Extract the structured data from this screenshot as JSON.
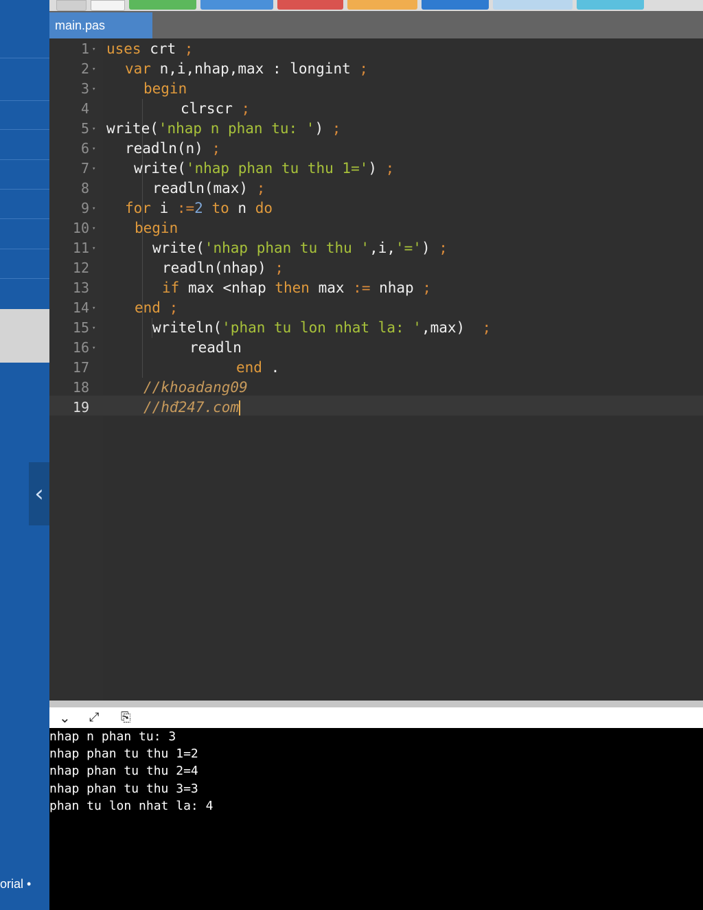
{
  "sidebar": {
    "collapse_glyph": "‹",
    "footer_text": "orial •"
  },
  "toolbar": {
    "colors": {
      "gray": "#cfcfcf",
      "run": "#5cb85c",
      "debug": "#4a90d9",
      "stop": "#d9534f",
      "share": "#f0ad4e",
      "save": "#2f7bd0",
      "beautify": "#b9d6ee",
      "extra": "#5bc0de"
    }
  },
  "tab": {
    "label": "main.pas"
  },
  "editor": {
    "active_line": 19,
    "lines": [
      {
        "n": "1",
        "fold": true
      },
      {
        "n": "2",
        "fold": true
      },
      {
        "n": "3",
        "fold": true
      },
      {
        "n": "4",
        "fold": false
      },
      {
        "n": "5",
        "fold": true
      },
      {
        "n": "6",
        "fold": true
      },
      {
        "n": "7",
        "fold": true
      },
      {
        "n": "8",
        "fold": false
      },
      {
        "n": "9",
        "fold": true
      },
      {
        "n": "10",
        "fold": true
      },
      {
        "n": "11",
        "fold": true
      },
      {
        "n": "12",
        "fold": false
      },
      {
        "n": "13",
        "fold": false
      },
      {
        "n": "14",
        "fold": true
      },
      {
        "n": "15",
        "fold": true
      },
      {
        "n": "16",
        "fold": true
      },
      {
        "n": "17",
        "fold": false
      },
      {
        "n": "18",
        "fold": false
      },
      {
        "n": "19",
        "fold": false
      }
    ],
    "code": [
      [
        {
          "t": "uses",
          "c": "kw"
        },
        {
          "t": " crt "
        },
        {
          "t": ";",
          "c": "op"
        }
      ],
      [
        {
          "t": "var",
          "c": "kw"
        },
        {
          "t": " n,i,nhap,max : longint "
        },
        {
          "t": ";",
          "c": "op"
        }
      ],
      [
        {
          "t": "begin",
          "c": "kw"
        }
      ],
      [
        {
          "t": "clrscr "
        },
        {
          "t": ";",
          "c": "op"
        }
      ],
      [
        {
          "t": "write("
        },
        {
          "t": "'nhap n phan tu: '",
          "c": "st"
        },
        {
          "t": ") "
        },
        {
          "t": ";",
          "c": "op"
        }
      ],
      [
        {
          "t": "readln(n) "
        },
        {
          "t": ";",
          "c": "op"
        }
      ],
      [
        {
          "t": "write("
        },
        {
          "t": "'nhap phan tu thu 1='",
          "c": "st"
        },
        {
          "t": ") "
        },
        {
          "t": ";",
          "c": "op"
        }
      ],
      [
        {
          "t": "readln(max) "
        },
        {
          "t": ";",
          "c": "op"
        }
      ],
      [
        {
          "t": "for",
          "c": "kw"
        },
        {
          "t": " i "
        },
        {
          "t": ":=",
          "c": "op"
        },
        {
          "t": "2",
          "c": "nm"
        },
        {
          "t": " "
        },
        {
          "t": "to",
          "c": "kw"
        },
        {
          "t": " n "
        },
        {
          "t": "do",
          "c": "kw"
        }
      ],
      [
        {
          "t": "begin",
          "c": "kw"
        }
      ],
      [
        {
          "t": "write("
        },
        {
          "t": "'nhap phan tu thu '",
          "c": "st"
        },
        {
          "t": ",i,"
        },
        {
          "t": "'='",
          "c": "st"
        },
        {
          "t": ") "
        },
        {
          "t": ";",
          "c": "op"
        }
      ],
      [
        {
          "t": "readln(nhap) "
        },
        {
          "t": ";",
          "c": "op"
        }
      ],
      [
        {
          "t": "if",
          "c": "kw"
        },
        {
          "t": " max <nhap "
        },
        {
          "t": "then",
          "c": "kw"
        },
        {
          "t": " max "
        },
        {
          "t": ":=",
          "c": "op"
        },
        {
          "t": " nhap "
        },
        {
          "t": ";",
          "c": "op"
        }
      ],
      [
        {
          "t": "end",
          "c": "kw"
        },
        {
          "t": " "
        },
        {
          "t": ";",
          "c": "op"
        }
      ],
      [
        {
          "t": "writeln("
        },
        {
          "t": "'phan tu lon nhat la: '",
          "c": "st"
        },
        {
          "t": ",max)  "
        },
        {
          "t": ";",
          "c": "op"
        }
      ],
      [
        {
          "t": "readln"
        }
      ],
      [
        {
          "t": "end",
          "c": "kw"
        },
        {
          "t": " ."
        }
      ],
      [
        {
          "t": "//khoadang09",
          "c": "cm"
        }
      ],
      [
        {
          "t": "//hđ247.com",
          "c": "cm"
        }
      ]
    ]
  },
  "console": {
    "icons": [
      "chevron-down-icon",
      "expand-icon",
      "copy-icon"
    ],
    "output": [
      "nhap n phan tu: 3",
      "nhap phan tu thu 1=2",
      "nhap phan tu thu 2=4",
      "nhap phan tu thu 3=3",
      "phan tu lon nhat la: 4"
    ]
  }
}
